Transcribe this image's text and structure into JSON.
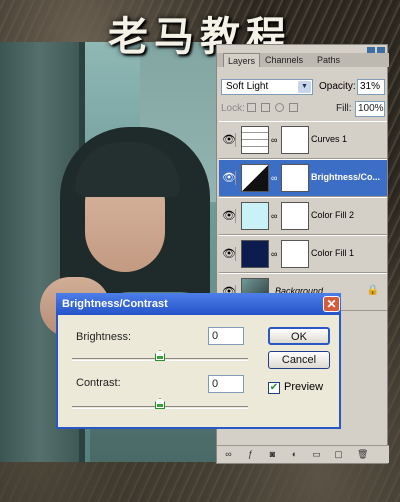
{
  "title": "老马教程",
  "layers_panel": {
    "tabs": [
      "Layers",
      "Channels",
      "Paths"
    ],
    "blend_mode": "Soft Light",
    "opacity_label": "Opacity:",
    "opacity_value": "31%",
    "lock_label": "Lock:",
    "fill_label": "Fill:",
    "fill_value": "100%",
    "layers": [
      {
        "name": "Curves 1",
        "selected": false
      },
      {
        "name": "Brightness/Co...",
        "selected": true
      },
      {
        "name": "Color Fill 2",
        "selected": false
      },
      {
        "name": "Color Fill 1",
        "selected": false
      },
      {
        "name": "Background",
        "selected": false
      }
    ]
  },
  "dialog": {
    "title": "Brightness/Contrast",
    "close": "✕",
    "brightness_label": "Brightness:",
    "brightness_value": "0",
    "contrast_label": "Contrast:",
    "contrast_value": "0",
    "ok_label": "OK",
    "cancel_label": "Cancel",
    "preview_label": "Preview",
    "preview_checked": true,
    "brightness_slider_fraction": 0.5,
    "contrast_slider_fraction": 0.5
  },
  "colors": {
    "selected_layer": "#3d6ec6",
    "dialog_titlebar": "#2553c9",
    "color_fill_2": "#c8f2f6",
    "color_fill_1": "#0d1c4e"
  }
}
